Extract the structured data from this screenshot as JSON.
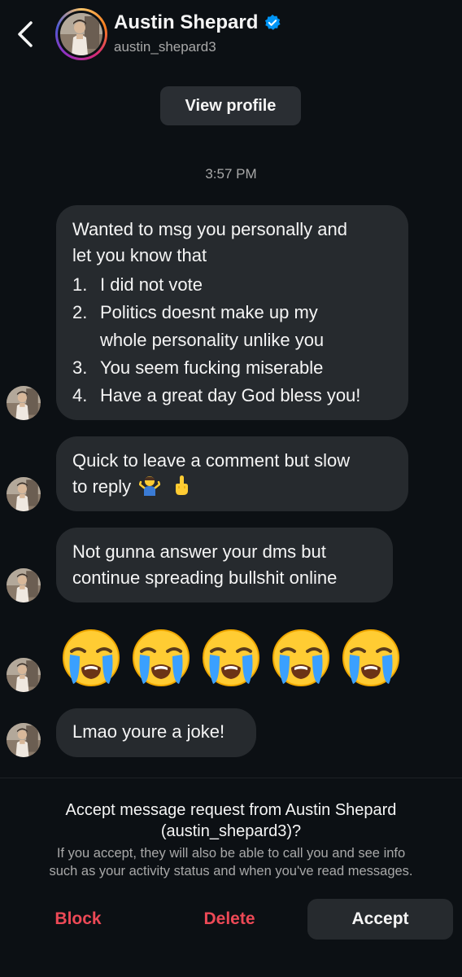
{
  "header": {
    "display_name": "Austin Shepard",
    "username": "austin_shepard3",
    "back_icon": "chevron-left-icon",
    "verified_icon": "verified-badge-icon",
    "accent_color": "#0095f6"
  },
  "view_profile_label": "View profile",
  "timestamp": "3:57 PM",
  "messages": {
    "m1_intro_1": "Wanted to msg you personally and",
    "m1_intro_2": "let you know that",
    "m1_items": [
      {
        "num": "1.",
        "text": "I did not vote"
      },
      {
        "num": "2.",
        "text": "Politics doesnt make up my"
      },
      {
        "num": "",
        "text": "whole personality unlike you"
      },
      {
        "num": "3.",
        "text": "You seem fucking miserable"
      },
      {
        "num": "4.",
        "text": "Have a great day God bless you!"
      }
    ],
    "m2_line1": "Quick to leave a comment but slow",
    "m2_line2": "to reply",
    "m2_emojis": [
      "person-shrugging-emoji",
      "middle-finger-emoji"
    ],
    "m3_line1": "Not gunna answer your dms but",
    "m3_line2": "continue spreading bullshit online",
    "m4_emojis": [
      "loudly-crying-face-emoji",
      "loudly-crying-face-emoji",
      "loudly-crying-face-emoji",
      "loudly-crying-face-emoji",
      "loudly-crying-face-emoji"
    ],
    "m5": "Lmao youre a joke!"
  },
  "request": {
    "title_line1": "Accept message request from Austin Shepard",
    "title_line2": "(austin_shepard3)?",
    "info_line1": "If you accept, they will also be able to call you and see info",
    "info_line2": "such as your activity status and when you've read messages."
  },
  "actions": {
    "block": "Block",
    "delete": "Delete",
    "accept": "Accept",
    "danger_color": "#ed4956"
  }
}
